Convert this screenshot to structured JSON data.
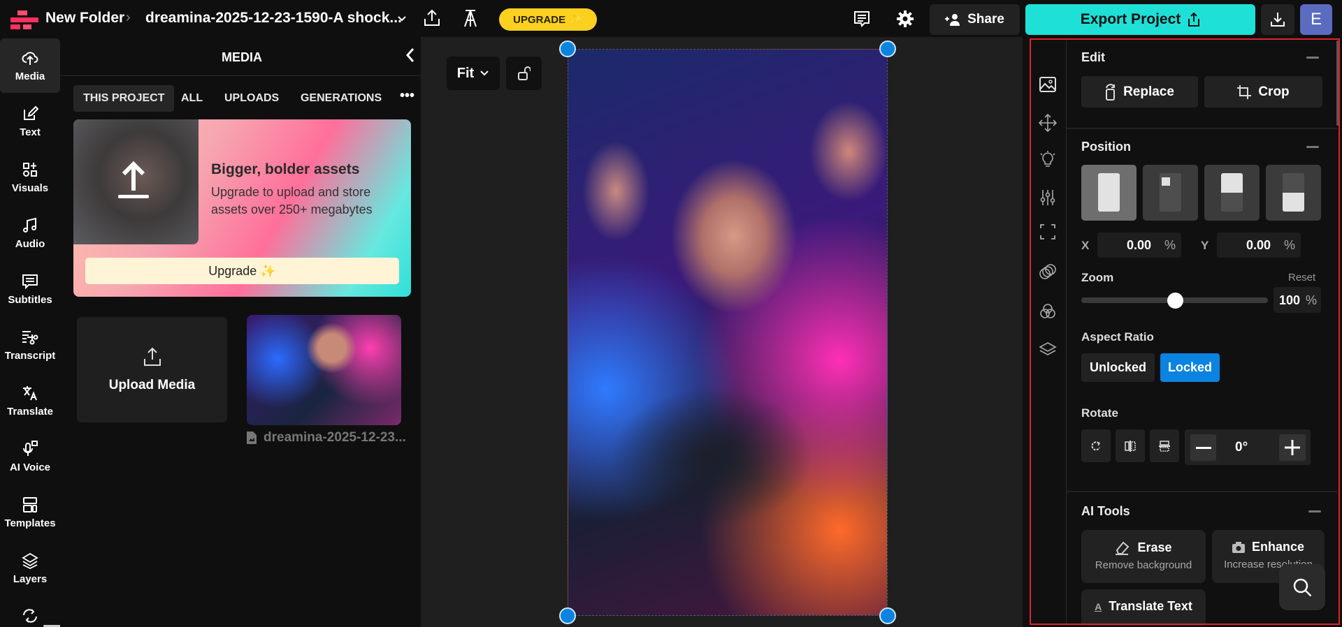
{
  "topbar": {
    "folder": "New Folder",
    "filename": "dreamina-2025-12-23-1590-A shock...",
    "upgrade": "UPGRADE",
    "share": "Share",
    "export": "Export Project",
    "avatar": "E"
  },
  "rail": [
    {
      "label": "Media",
      "icon": "cloud-upload-icon"
    },
    {
      "label": "Text",
      "icon": "edit-text-icon"
    },
    {
      "label": "Visuals",
      "icon": "shapes-icon"
    },
    {
      "label": "Audio",
      "icon": "music-note-icon"
    },
    {
      "label": "Subtitles",
      "icon": "subtitles-icon"
    },
    {
      "label": "Transcript",
      "icon": "transcript-icon"
    },
    {
      "label": "Translate",
      "icon": "translate-icon"
    },
    {
      "label": "AI Voice",
      "icon": "ai-voice-icon"
    },
    {
      "label": "Templates",
      "icon": "templates-icon"
    },
    {
      "label": "Layers",
      "icon": "layers-icon"
    }
  ],
  "media": {
    "title": "MEDIA",
    "tabs": [
      "THIS PROJECT",
      "ALL",
      "UPLOADS",
      "GENERATIONS"
    ],
    "active_tab": "THIS PROJECT",
    "promo": {
      "title": "Bigger, bolder assets",
      "body": "Upgrade to upload and store assets over 250+ megabytes",
      "button": "Upgrade ✨"
    },
    "upload": "Upload Media",
    "file_name": "dreamina-2025-12-23..."
  },
  "canvas": {
    "fit": "Fit"
  },
  "props": {
    "edit": {
      "title": "Edit",
      "replace": "Replace",
      "crop": "Crop"
    },
    "position": {
      "title": "Position",
      "x_label": "X",
      "x": "0.00",
      "y_label": "Y",
      "y": "0.00",
      "unit": "%"
    },
    "zoom": {
      "title": "Zoom",
      "reset": "Reset",
      "value": "100",
      "unit": "%",
      "fraction": 0.5
    },
    "aspect": {
      "title": "Aspect Ratio",
      "unlocked": "Unlocked",
      "locked": "Locked",
      "selected": "Locked"
    },
    "rotate": {
      "title": "Rotate",
      "value": "0°"
    },
    "ai": {
      "title": "AI Tools",
      "erase": "Erase",
      "erase_sub": "Remove background",
      "enhance": "Enhance",
      "enhance_sub": "Increase resolution",
      "translate": "Translate Text"
    }
  },
  "colors": {
    "accent": "#1ee0d6",
    "upgrade": "#fcd01f",
    "blue": "#0a84e0",
    "avatar": "#5b6bc0",
    "highlight": "#e0212b"
  }
}
